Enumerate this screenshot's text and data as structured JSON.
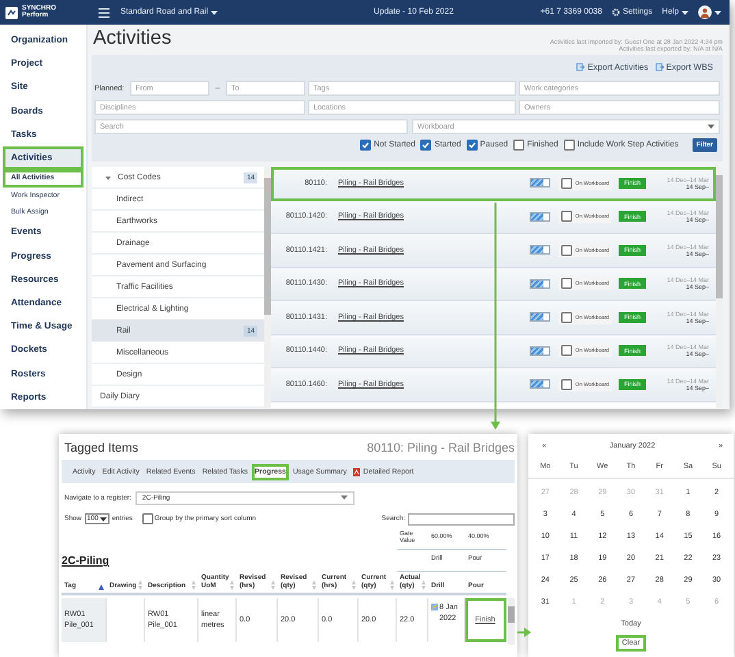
{
  "top_bar": {
    "logo_line_1": "SYNCHRO",
    "logo_line_2": "Perform",
    "project": "Standard Road and Rail",
    "update": "Update - 10 Feb 2022",
    "phone": "+61 7 3369 0038",
    "settings": "Settings",
    "help": "Help"
  },
  "sidebar": {
    "items": [
      {
        "label": "Organization",
        "kind": "main",
        "selected": false,
        "highlight": false
      },
      {
        "label": "Project",
        "kind": "main",
        "selected": false,
        "highlight": false
      },
      {
        "label": "Site",
        "kind": "main",
        "selected": false,
        "highlight": false
      },
      {
        "label": "Boards",
        "kind": "main",
        "selected": false,
        "highlight": false
      },
      {
        "label": "Tasks",
        "kind": "main",
        "selected": false,
        "highlight": false
      },
      {
        "label": "Activities",
        "kind": "main",
        "selected": true,
        "highlight": true
      },
      {
        "label": "All Activities",
        "kind": "sub",
        "selected": true,
        "highlight": true
      },
      {
        "label": "Work Inspector",
        "kind": "sub",
        "selected": false,
        "highlight": false
      },
      {
        "label": "Bulk Assign",
        "kind": "sub",
        "selected": false,
        "highlight": false
      },
      {
        "label": "Events",
        "kind": "main",
        "selected": false,
        "highlight": false
      },
      {
        "label": "Progress",
        "kind": "main",
        "selected": false,
        "highlight": false
      },
      {
        "label": "Resources",
        "kind": "main",
        "selected": false,
        "highlight": false
      },
      {
        "label": "Attendance",
        "kind": "main",
        "selected": false,
        "highlight": false
      },
      {
        "label": "Time & Usage",
        "kind": "main",
        "selected": false,
        "highlight": false
      },
      {
        "label": "Dockets",
        "kind": "main",
        "selected": false,
        "highlight": false
      },
      {
        "label": "Rosters",
        "kind": "main",
        "selected": false,
        "highlight": false
      },
      {
        "label": "Reports",
        "kind": "main",
        "selected": false,
        "highlight": false
      }
    ]
  },
  "main": {
    "title": "Activities",
    "import_info": [
      "Activities last imported by: Guest One at 28 Jan 2022 4:34 pm",
      "Activities last exported by: N/A at N/A"
    ],
    "export_buttons": [
      "Export Activities",
      "Export WBS"
    ],
    "filters": {
      "planned_label": "Planned:",
      "from": {
        "placeholder": "From"
      },
      "dash": "–",
      "to": {
        "placeholder": "To"
      },
      "tags": {
        "placeholder": "Tags"
      },
      "work_categories": {
        "placeholder": "Work categories"
      },
      "disciplines": {
        "placeholder": "Disciplines"
      },
      "locations": {
        "placeholder": "Locations"
      },
      "owners": {
        "placeholder": "Owners"
      },
      "search": {
        "placeholder": "Search"
      },
      "workboard": {
        "placeholder": "Workboard"
      }
    },
    "status_filters": [
      {
        "label": "Not Started",
        "checked": true
      },
      {
        "label": "Started",
        "checked": true
      },
      {
        "label": "Paused",
        "checked": true
      },
      {
        "label": "Finished",
        "checked": false
      },
      {
        "label": "Include Work Step Activities",
        "checked": false
      }
    ],
    "filter_button": "Filter",
    "tree": [
      {
        "label": "Cost Codes",
        "count": "14",
        "expanded": true,
        "selected": false,
        "children": [
          {
            "label": "Indirect",
            "selected": false
          },
          {
            "label": "Earthworks",
            "selected": false
          },
          {
            "label": "Drainage",
            "selected": false
          },
          {
            "label": "Pavement and Surfacing",
            "selected": false
          },
          {
            "label": "Traffic Facilities",
            "selected": false
          },
          {
            "label": "Electrical & Lighting",
            "selected": false
          },
          {
            "label": "Rail",
            "count": "14",
            "selected": true
          },
          {
            "label": "Miscellaneous",
            "selected": false
          },
          {
            "label": "Design",
            "selected": false
          }
        ]
      },
      {
        "label": "Daily Diary",
        "selected": false
      }
    ],
    "activities": [
      {
        "code": "80110:",
        "name": "Piling - Rail Bridges",
        "level": 0.7,
        "workboard": "On Workboard",
        "on_workboard": false,
        "action": "Finish",
        "dates": "14 Dec–14 Mar",
        "date_2": "14 Sep–",
        "highlight": true
      },
      {
        "code": "80110.1420:",
        "name": "Piling - Rail Bridges",
        "level": 0.7,
        "workboard": "On Workboard",
        "on_workboard": false,
        "action": "Finish",
        "dates": "14 Dec–14 Mar",
        "date_2": "14 Sep–",
        "highlight": false
      },
      {
        "code": "80110.1421:",
        "name": "Piling - Rail Bridges",
        "level": 0.7,
        "workboard": "On Workboard",
        "on_workboard": false,
        "action": "Finish",
        "dates": "14 Dec–14 Mar",
        "date_2": "14 Sep–",
        "highlight": false
      },
      {
        "code": "80110.1430:",
        "name": "Piling - Rail Bridges",
        "level": 0.7,
        "workboard": "On Workboard",
        "on_workboard": false,
        "action": "Finish",
        "dates": "14 Dec–14 Mar",
        "date_2": "14 Sep–",
        "highlight": false
      },
      {
        "code": "80110.1431:",
        "name": "Piling - Rail Bridges",
        "level": 0.7,
        "workboard": "On Workboard",
        "on_workboard": false,
        "action": "Finish",
        "dates": "14 Dec–14 Mar",
        "date_2": "14 Sep–",
        "highlight": false
      },
      {
        "code": "80110.1440:",
        "name": "Piling - Rail Bridges",
        "level": 0.7,
        "workboard": "On Workboard",
        "on_workboard": false,
        "action": "Finish",
        "dates": "14 Dec–14 Mar",
        "date_2": "14 Sep–",
        "highlight": false
      },
      {
        "code": "80110.1460:",
        "name": "Piling - Rail Bridges",
        "level": 0.7,
        "workboard": "On Workboard",
        "on_workboard": false,
        "action": "Finish",
        "dates": "14 Dec–14 Mar",
        "date_2": "14 Sep–",
        "highlight": false
      }
    ]
  },
  "tagged_items": {
    "title": "Tagged Items",
    "activity": "80110: Piling - Rail Bridges",
    "tabs": [
      {
        "label": "Activity",
        "kind": "text",
        "selected": false,
        "highlight": false
      },
      {
        "label": "Edit Activity",
        "kind": "text",
        "selected": false,
        "highlight": false
      },
      {
        "label": "Related Events",
        "kind": "text",
        "selected": false,
        "highlight": false
      },
      {
        "label": "Related Tasks",
        "kind": "text",
        "selected": false,
        "highlight": false
      },
      {
        "label": "Progress",
        "kind": "text",
        "selected": true,
        "highlight": true
      },
      {
        "label": "Usage Summary",
        "kind": "text",
        "selected": false,
        "highlight": false
      },
      {
        "label": "Detailed Report",
        "kind": "pdf",
        "selected": false,
        "highlight": false
      }
    ],
    "navigate_label": "Navigate to a register:",
    "register": "2C-Piling",
    "show_label": "Show",
    "page_size": "100",
    "entries_label": "entries",
    "group_option": {
      "label": "Group by the primary sort column",
      "checked": false
    },
    "search_label": "Search:",
    "gate_label": "Gate Value",
    "gate_values": [
      "60.00%",
      "40.00%"
    ],
    "register_title": "2C-Piling",
    "steps": [
      "Drill",
      "Pour"
    ],
    "columns": [
      {
        "label": "Tag",
        "sorted": true
      },
      {
        "label": "Drawing",
        "sorted": false
      },
      {
        "label": "Description",
        "sorted": false
      },
      {
        "label": "Quantity UoM",
        "sorted": false
      },
      {
        "label": "Revised (hrs)",
        "sorted": false
      },
      {
        "label": "Revised (qty)",
        "sorted": false
      },
      {
        "label": "Current (hrs)",
        "sorted": false
      },
      {
        "label": "Current (qty)",
        "sorted": false
      },
      {
        "label": "Actual (qty)",
        "sorted": false
      },
      {
        "label": "Drill"
      },
      {
        "label": "Pour"
      }
    ],
    "rows": [
      {
        "tag": "RW01 Pile_001",
        "description": "RW01 Pile_001",
        "uom": "linear metres",
        "revised_hrs": "0.0",
        "revised_qty": "20.0",
        "current_hrs": "0.0",
        "current_qty": "20.0",
        "actual_qty": "22.0",
        "drill": "8 Jan 2022",
        "pour": "Finish",
        "pour_highlight": true
      }
    ]
  },
  "calendar": {
    "prev": "«",
    "month": "January 2022",
    "next": "»",
    "weekdays": [
      "Mo",
      "Tu",
      "We",
      "Th",
      "Fr",
      "Sa",
      "Su"
    ],
    "weeks": [
      [
        {
          "day": "27",
          "in_month": false
        },
        {
          "day": "28",
          "in_month": false
        },
        {
          "day": "29",
          "in_month": false
        },
        {
          "day": "30",
          "in_month": false
        },
        {
          "day": "31",
          "in_month": false
        },
        {
          "day": "1",
          "in_month": true
        },
        {
          "day": "2",
          "in_month": true
        }
      ],
      [
        {
          "day": "3",
          "in_month": true
        },
        {
          "day": "4",
          "in_month": true
        },
        {
          "day": "5",
          "in_month": true
        },
        {
          "day": "6",
          "in_month": true
        },
        {
          "day": "7",
          "in_month": true
        },
        {
          "day": "8",
          "in_month": true
        },
        {
          "day": "9",
          "in_month": true
        }
      ],
      [
        {
          "day": "10",
          "in_month": true
        },
        {
          "day": "11",
          "in_month": true
        },
        {
          "day": "12",
          "in_month": true
        },
        {
          "day": "13",
          "in_month": true
        },
        {
          "day": "14",
          "in_month": true
        },
        {
          "day": "15",
          "in_month": true
        },
        {
          "day": "16",
          "in_month": true
        }
      ],
      [
        {
          "day": "17",
          "in_month": true
        },
        {
          "day": "18",
          "in_month": true
        },
        {
          "day": "19",
          "in_month": true
        },
        {
          "day": "20",
          "in_month": true
        },
        {
          "day": "21",
          "in_month": true
        },
        {
          "day": "22",
          "in_month": true
        },
        {
          "day": "23",
          "in_month": true
        }
      ],
      [
        {
          "day": "24",
          "in_month": true
        },
        {
          "day": "25",
          "in_month": true
        },
        {
          "day": "26",
          "in_month": true
        },
        {
          "day": "27",
          "in_month": true
        },
        {
          "day": "28",
          "in_month": true
        },
        {
          "day": "29",
          "in_month": true
        },
        {
          "day": "30",
          "in_month": true
        }
      ],
      [
        {
          "day": "31",
          "in_month": true
        },
        {
          "day": "1",
          "in_month": false
        },
        {
          "day": "2",
          "in_month": false
        },
        {
          "day": "3",
          "in_month": false
        },
        {
          "day": "4",
          "in_month": false
        },
        {
          "day": "5",
          "in_month": false
        },
        {
          "day": "6",
          "in_month": false
        }
      ]
    ],
    "today": "Today",
    "clear": "Clear",
    "clear_highlight": true
  }
}
